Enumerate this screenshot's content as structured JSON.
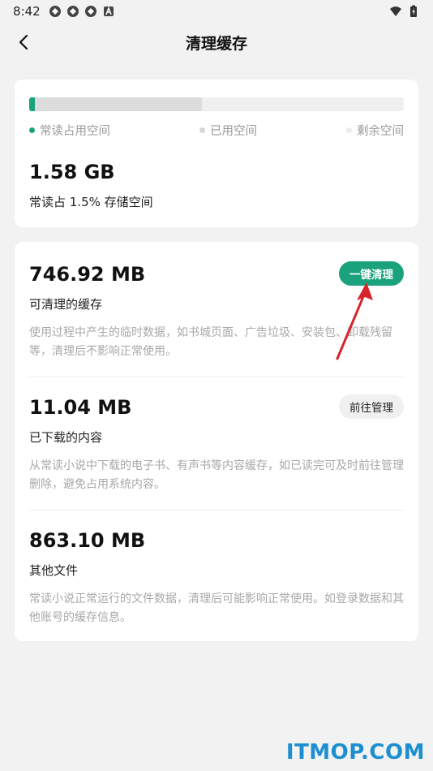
{
  "status_bar": {
    "time": "8:42",
    "left_icons": [
      "app-notification-icon",
      "app-notification-icon",
      "app-notification-icon",
      "a-notification-icon"
    ],
    "right_icons": [
      "wifi-icon",
      "battery-icon"
    ]
  },
  "header": {
    "back_icon": "chevron-left-icon",
    "title": "清理缓存"
  },
  "storage": {
    "app_fraction": 0.015,
    "used_fraction": 0.46,
    "legend": [
      {
        "label": "常读占用空间",
        "color": "#1aa27c"
      },
      {
        "label": "已用空间",
        "color": "#d6d6d6"
      },
      {
        "label": "剩余空间",
        "color": "#ececec"
      }
    ],
    "size": "1.58 GB",
    "note": "常读占 1.5% 存储空间"
  },
  "cache_sections": [
    {
      "size": "746.92 MB",
      "title": "可清理的缓存",
      "description": "使用过程中产生的临时数据，如书城页面、广告垃圾、安装包、卸载残留等，清理后不影响正常使用。",
      "button": "一键清理"
    },
    {
      "size": "11.04 MB",
      "title": "已下载的内容",
      "description": "从常读小说中下载的电子书、有声书等内容缓存，如已读完可及时前往管理删除，避免占用系统内容。",
      "button": "前往管理"
    },
    {
      "size": "863.10 MB",
      "title": "其他文件",
      "description": "常读小说正常运行的文件数据，清理后可能影响正常使用。如登录数据和其他账号的缓存信息。"
    }
  ],
  "watermark": "ITMOP.COM",
  "colors": {
    "accent": "#1aa27c",
    "annotation_arrow": "#d9232a",
    "watermark": "#1d8fd0"
  }
}
